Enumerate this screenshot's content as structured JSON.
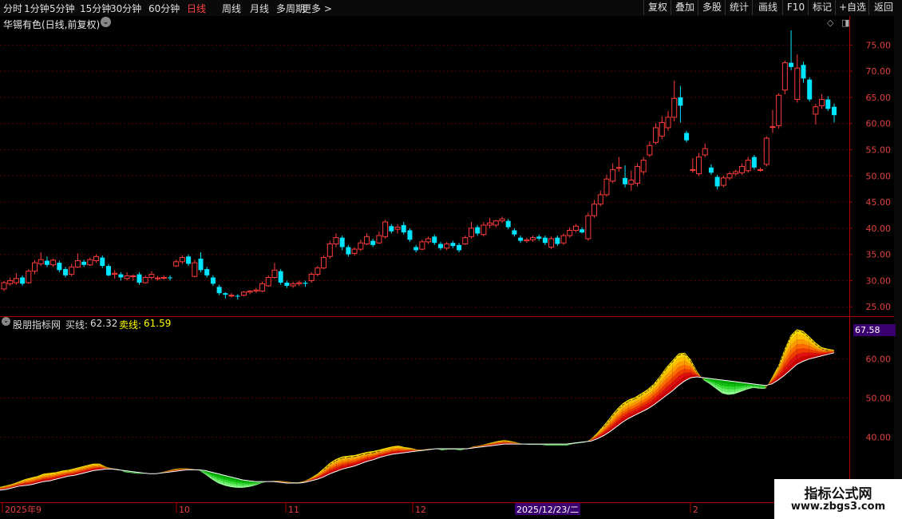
{
  "toolbar": {
    "periods": [
      "分时",
      "1分钟",
      "5分钟",
      "15分钟",
      "30分钟",
      "60分钟",
      "日线",
      "周线",
      "月线",
      "多周期",
      "更多 >"
    ],
    "active_period": "日线",
    "right_buttons": [
      "复权",
      "叠加",
      "多股",
      "统计",
      "画线",
      "F10",
      "标记",
      "+自选",
      "返回"
    ]
  },
  "main_chart": {
    "title": "华锡有色(日线,前复权)",
    "price_ticks": [
      "75.00",
      "70.00",
      "65.00",
      "60.00",
      "55.00",
      "50.00",
      "45.00",
      "40.00",
      "35.00",
      "30.00",
      "25.00"
    ],
    "candles": [
      [
        28.4,
        29.6,
        28.0,
        29.9
      ],
      [
        29.4,
        30.0,
        29.0,
        30.6
      ],
      [
        29.6,
        30.4,
        29.2,
        31.4
      ],
      [
        30.6,
        29.4,
        29.0,
        31.0
      ],
      [
        29.6,
        31.8,
        29.4,
        32.2
      ],
      [
        31.8,
        33.4,
        31.2,
        33.9
      ],
      [
        33.2,
        34.0,
        32.8,
        35.4
      ],
      [
        33.8,
        33.0,
        32.6,
        34.6
      ],
      [
        33.0,
        33.9,
        32.6,
        34.2
      ],
      [
        33.4,
        32.0,
        31.6,
        33.8
      ],
      [
        32.2,
        31.0,
        30.6,
        32.6
      ],
      [
        31.2,
        32.6,
        30.8,
        33.2
      ],
      [
        32.6,
        33.8,
        32.4,
        35.2
      ],
      [
        33.6,
        33.0,
        32.6,
        34.0
      ],
      [
        33.0,
        34.0,
        32.8,
        34.4
      ],
      [
        33.8,
        34.6,
        33.4,
        35.0
      ],
      [
        34.4,
        32.8,
        32.4,
        34.8
      ],
      [
        32.8,
        31.0,
        30.8,
        33.2
      ],
      [
        31.2,
        31.4,
        30.4,
        32.0
      ],
      [
        31.2,
        30.6,
        30.0,
        31.6
      ],
      [
        30.4,
        30.9,
        30.0,
        31.6
      ],
      [
        30.8,
        30.9,
        30.0,
        31.2
      ],
      [
        31.2,
        29.6,
        29.2,
        31.6
      ],
      [
        29.6,
        30.6,
        29.4,
        31.0
      ],
      [
        30.6,
        31.2,
        30.2,
        31.8
      ],
      [
        30.4,
        30.5,
        30.0,
        30.9
      ],
      [
        30.6,
        30.6,
        30.2,
        31.0
      ],
      [
        30.6,
        30.5,
        30.0,
        31.0
      ],
      [
        32.8,
        33.6,
        32.6,
        34.0
      ],
      [
        33.6,
        34.4,
        33.2,
        34.8
      ],
      [
        34.6,
        33.2,
        32.8,
        35.0
      ],
      [
        30.8,
        33.4,
        30.6,
        34.0
      ],
      [
        34.2,
        32.0,
        31.6,
        35.4
      ],
      [
        32.2,
        31.0,
        30.6,
        32.6
      ],
      [
        30.6,
        29.4,
        29.0,
        31.0
      ],
      [
        28.8,
        27.6,
        27.2,
        29.2
      ],
      [
        27.6,
        27.3,
        26.6,
        27.8
      ],
      [
        27.2,
        27.2,
        26.8,
        27.6
      ],
      [
        27.1,
        27.0,
        26.4,
        27.4
      ],
      [
        27.2,
        27.8,
        27.0,
        28.0
      ],
      [
        27.8,
        28.0,
        27.4,
        28.2
      ],
      [
        28.0,
        28.2,
        27.6,
        28.6
      ],
      [
        28.0,
        29.4,
        27.8,
        29.8
      ],
      [
        29.0,
        30.6,
        28.8,
        31.0
      ],
      [
        30.6,
        32.0,
        30.4,
        33.4
      ],
      [
        31.8,
        29.6,
        29.2,
        32.2
      ],
      [
        29.6,
        29.0,
        28.6,
        30.0
      ],
      [
        29.0,
        29.4,
        28.6,
        29.8
      ],
      [
        29.4,
        29.6,
        29.0,
        30.0
      ],
      [
        29.6,
        29.4,
        28.8,
        30.0
      ],
      [
        30.0,
        31.2,
        29.6,
        31.6
      ],
      [
        31.2,
        32.4,
        30.8,
        32.8
      ],
      [
        32.4,
        34.4,
        32.2,
        34.8
      ],
      [
        34.6,
        37.0,
        34.2,
        37.6
      ],
      [
        37.0,
        38.2,
        36.4,
        39.0
      ],
      [
        38.2,
        36.4,
        35.8,
        38.6
      ],
      [
        36.4,
        35.0,
        34.6,
        36.8
      ],
      [
        35.2,
        36.0,
        34.8,
        36.4
      ],
      [
        36.0,
        37.2,
        35.6,
        37.8
      ],
      [
        37.0,
        38.4,
        36.8,
        39.0
      ],
      [
        37.6,
        36.8,
        36.4,
        38.0
      ],
      [
        37.2,
        38.6,
        37.0,
        39.4
      ],
      [
        38.4,
        41.2,
        38.0,
        41.6
      ],
      [
        40.4,
        39.4,
        39.0,
        40.8
      ],
      [
        39.8,
        40.2,
        39.0,
        40.8
      ],
      [
        40.6,
        39.2,
        38.8,
        41.2
      ],
      [
        39.6,
        37.8,
        37.4,
        40.0
      ],
      [
        36.4,
        35.8,
        35.4,
        36.8
      ],
      [
        36.0,
        37.4,
        35.8,
        37.8
      ],
      [
        37.4,
        38.0,
        37.0,
        38.4
      ],
      [
        38.4,
        37.2,
        36.8,
        38.8
      ],
      [
        37.0,
        36.2,
        35.8,
        37.4
      ],
      [
        36.2,
        37.0,
        35.8,
        37.4
      ],
      [
        37.2,
        36.6,
        36.2,
        37.6
      ],
      [
        36.8,
        35.8,
        35.4,
        37.2
      ],
      [
        37.0,
        38.2,
        36.8,
        38.6
      ],
      [
        38.4,
        40.0,
        38.0,
        41.2
      ],
      [
        40.2,
        39.0,
        38.6,
        40.6
      ],
      [
        38.8,
        40.6,
        38.4,
        41.2
      ],
      [
        40.6,
        41.0,
        40.0,
        42.0
      ],
      [
        40.6,
        41.4,
        40.2,
        41.6
      ],
      [
        41.4,
        41.8,
        41.0,
        42.2
      ],
      [
        41.4,
        40.2,
        39.8,
        41.8
      ],
      [
        39.6,
        38.8,
        38.4,
        40.0
      ],
      [
        38.2,
        37.6,
        37.2,
        38.6
      ],
      [
        37.6,
        37.8,
        37.2,
        38.2
      ],
      [
        37.8,
        38.2,
        37.4,
        38.6
      ],
      [
        38.4,
        38.0,
        37.6,
        38.8
      ],
      [
        38.2,
        37.2,
        36.8,
        38.6
      ],
      [
        36.4,
        38.0,
        36.0,
        38.4
      ],
      [
        38.2,
        37.0,
        36.6,
        38.6
      ],
      [
        37.2,
        38.6,
        36.8,
        39.0
      ],
      [
        38.6,
        39.6,
        38.2,
        40.2
      ],
      [
        39.6,
        40.4,
        39.2,
        40.8
      ],
      [
        39.8,
        39.2,
        39.0,
        40.2
      ],
      [
        38.0,
        42.4,
        37.6,
        43.0
      ],
      [
        42.4,
        44.6,
        42.0,
        45.4
      ],
      [
        44.6,
        46.4,
        44.2,
        47.2
      ],
      [
        46.4,
        49.4,
        46.0,
        50.2
      ],
      [
        49.0,
        51.2,
        48.6,
        52.4
      ],
      [
        51.6,
        51.6,
        50.8,
        53.6
      ],
      [
        49.6,
        48.4,
        47.8,
        52.0
      ],
      [
        48.4,
        49.2,
        47.2,
        51.0
      ],
      [
        48.6,
        51.8,
        48.0,
        52.4
      ],
      [
        50.8,
        53.0,
        50.2,
        53.6
      ],
      [
        54.0,
        55.8,
        53.6,
        56.6
      ],
      [
        56.4,
        59.2,
        56.0,
        60.0
      ],
      [
        57.6,
        60.2,
        57.0,
        61.4
      ],
      [
        59.2,
        61.2,
        58.6,
        62.4
      ],
      [
        61.2,
        64.8,
        60.4,
        68.2
      ],
      [
        65.0,
        63.4,
        60.2,
        67.2
      ],
      [
        58.2,
        56.8,
        56.4,
        58.6
      ],
      [
        51.2,
        51.2,
        50.6,
        53.4
      ],
      [
        50.4,
        53.6,
        50.0,
        54.4
      ],
      [
        54.0,
        55.2,
        53.6,
        56.2
      ],
      [
        51.6,
        50.6,
        50.2,
        52.2
      ],
      [
        49.8,
        48.0,
        47.4,
        50.2
      ],
      [
        48.2,
        49.6,
        47.8,
        50.0
      ],
      [
        49.6,
        50.4,
        49.2,
        50.8
      ],
      [
        50.4,
        50.8,
        50.0,
        51.2
      ],
      [
        50.6,
        51.8,
        50.2,
        52.4
      ],
      [
        51.0,
        53.0,
        50.6,
        53.6
      ],
      [
        53.6,
        51.6,
        51.2,
        54.0
      ],
      [
        51.2,
        51.2,
        50.8,
        51.6
      ],
      [
        52.2,
        57.2,
        51.8,
        57.6
      ],
      [
        59.4,
        59.4,
        58.2,
        62.6
      ],
      [
        59.6,
        65.4,
        59.0,
        65.8
      ],
      [
        66.4,
        71.6,
        65.6,
        72.0
      ],
      [
        71.6,
        70.8,
        70.2,
        77.8
      ],
      [
        64.6,
        70.6,
        64.0,
        73.2
      ],
      [
        71.2,
        68.6,
        67.8,
        71.8
      ],
      [
        68.4,
        64.6,
        64.2,
        68.8
      ],
      [
        61.8,
        63.2,
        59.8,
        63.8
      ],
      [
        63.4,
        64.6,
        62.8,
        65.6
      ],
      [
        64.6,
        62.8,
        62.4,
        65.2
      ],
      [
        63.2,
        61.6,
        60.2,
        63.8
      ]
    ]
  },
  "indicator": {
    "title": "股朋指标网",
    "buy_label": "买线:",
    "buy_value": "62.32",
    "sell_label": "卖线:",
    "sell_value": "61.59",
    "current_value": "67.58",
    "ticks": [
      "60.00",
      "50.00",
      "40.00"
    ],
    "band": [
      [
        26.4,
        27.2
      ],
      [
        26.6,
        27.6
      ],
      [
        27.0,
        28.0
      ],
      [
        27.4,
        28.6
      ],
      [
        27.6,
        29.2
      ],
      [
        27.8,
        29.6
      ],
      [
        28.2,
        30.0
      ],
      [
        28.6,
        30.6
      ],
      [
        28.8,
        30.8
      ],
      [
        29.2,
        31.0
      ],
      [
        29.6,
        31.4
      ],
      [
        30.0,
        31.6
      ],
      [
        30.2,
        32.0
      ],
      [
        30.6,
        32.4
      ],
      [
        31.0,
        32.8
      ],
      [
        31.4,
        33.2
      ],
      [
        31.6,
        33.2
      ],
      [
        31.8,
        32.4
      ],
      [
        31.8,
        32.0
      ],
      [
        31.6,
        31.8
      ],
      [
        31.4,
        31.0
      ],
      [
        31.2,
        30.8
      ],
      [
        31.0,
        30.6
      ],
      [
        30.8,
        30.6
      ],
      [
        30.6,
        30.6
      ],
      [
        30.6,
        30.6
      ],
      [
        30.8,
        31.0
      ],
      [
        31.0,
        31.4
      ],
      [
        31.2,
        31.8
      ],
      [
        31.4,
        32.0
      ],
      [
        31.6,
        32.0
      ],
      [
        31.6,
        31.8
      ],
      [
        31.6,
        31.4
      ],
      [
        31.4,
        30.4
      ],
      [
        31.0,
        29.2
      ],
      [
        30.6,
        28.2
      ],
      [
        30.2,
        27.6
      ],
      [
        29.8,
        27.2
      ],
      [
        29.4,
        27.0
      ],
      [
        29.0,
        27.0
      ],
      [
        28.8,
        27.2
      ],
      [
        28.6,
        27.6
      ],
      [
        28.6,
        28.2
      ],
      [
        28.6,
        28.6
      ],
      [
        28.6,
        28.8
      ],
      [
        28.4,
        28.8
      ],
      [
        28.2,
        28.6
      ],
      [
        28.2,
        28.4
      ],
      [
        28.2,
        28.4
      ],
      [
        28.4,
        28.8
      ],
      [
        28.8,
        29.6
      ],
      [
        29.2,
        30.6
      ],
      [
        29.8,
        32.0
      ],
      [
        30.6,
        33.4
      ],
      [
        31.2,
        34.4
      ],
      [
        31.8,
        35.0
      ],
      [
        32.2,
        35.2
      ],
      [
        32.6,
        35.4
      ],
      [
        33.2,
        35.8
      ],
      [
        33.8,
        36.2
      ],
      [
        34.2,
        36.4
      ],
      [
        34.8,
        36.8
      ],
      [
        35.2,
        37.2
      ],
      [
        35.6,
        37.6
      ],
      [
        35.8,
        37.8
      ],
      [
        36.0,
        37.4
      ],
      [
        36.2,
        37.2
      ],
      [
        36.4,
        36.8
      ],
      [
        36.6,
        36.8
      ],
      [
        36.8,
        37.0
      ],
      [
        37.0,
        37.0
      ],
      [
        37.0,
        36.6
      ],
      [
        37.0,
        36.8
      ],
      [
        37.0,
        36.8
      ],
      [
        37.0,
        36.6
      ],
      [
        37.0,
        37.0
      ],
      [
        37.2,
        37.6
      ],
      [
        37.4,
        37.8
      ],
      [
        37.6,
        38.2
      ],
      [
        37.8,
        38.6
      ],
      [
        38.0,
        39.0
      ],
      [
        38.2,
        39.2
      ],
      [
        38.2,
        39.0
      ],
      [
        38.2,
        38.6
      ],
      [
        38.2,
        38.2
      ],
      [
        38.2,
        38.0
      ],
      [
        38.2,
        38.0
      ],
      [
        38.2,
        38.0
      ],
      [
        38.2,
        37.8
      ],
      [
        38.2,
        37.8
      ],
      [
        38.2,
        37.8
      ],
      [
        38.2,
        37.8
      ],
      [
        38.4,
        38.2
      ],
      [
        38.6,
        38.4
      ],
      [
        38.8,
        38.6
      ],
      [
        39.0,
        39.6
      ],
      [
        39.6,
        41.2
      ],
      [
        40.4,
        43.0
      ],
      [
        41.4,
        45.0
      ],
      [
        42.6,
        47.0
      ],
      [
        43.8,
        48.6
      ],
      [
        44.8,
        49.6
      ],
      [
        45.6,
        50.2
      ],
      [
        46.4,
        51.2
      ],
      [
        47.2,
        52.2
      ],
      [
        48.2,
        53.6
      ],
      [
        49.4,
        55.6
      ],
      [
        50.6,
        57.8
      ],
      [
        51.8,
        59.6
      ],
      [
        53.2,
        61.4
      ],
      [
        54.4,
        61.6
      ],
      [
        55.2,
        59.8
      ],
      [
        55.4,
        56.8
      ],
      [
        55.2,
        54.6
      ],
      [
        55.0,
        53.6
      ],
      [
        54.8,
        52.4
      ],
      [
        54.6,
        51.2
      ],
      [
        54.4,
        50.8
      ],
      [
        54.2,
        51.0
      ],
      [
        54.0,
        51.6
      ],
      [
        53.8,
        52.2
      ],
      [
        53.6,
        52.6
      ],
      [
        53.4,
        52.4
      ],
      [
        53.2,
        52.4
      ],
      [
        53.6,
        55.2
      ],
      [
        54.6,
        58.2
      ],
      [
        55.8,
        62.4
      ],
      [
        57.2,
        66.0
      ],
      [
        58.6,
        67.6
      ],
      [
        59.4,
        67.2
      ],
      [
        60.0,
        65.8
      ],
      [
        60.4,
        64.2
      ],
      [
        60.8,
        63.0
      ],
      [
        61.2,
        62.6
      ],
      [
        61.6,
        62.3
      ]
    ]
  },
  "date_axis": {
    "labels": [
      "2025年9",
      "10",
      "11",
      "12",
      "2025/12/23/二",
      "2"
    ],
    "crosshair_label": "2025/12/23/二"
  },
  "watermark": {
    "title": "指标公式网",
    "url": "www.zbgs3.com"
  },
  "colors": {
    "up": "#ff3b3b",
    "down": "#00e5ff",
    "grid": "#5a0000",
    "axis": "#a00000",
    "sell_label": "#ffff00",
    "badge_bg": "#3a0070"
  }
}
